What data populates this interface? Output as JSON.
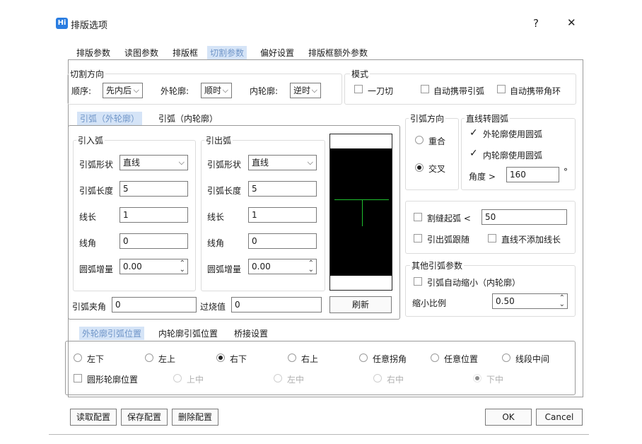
{
  "window": {
    "icon_text": "Hi",
    "title": "排版选项",
    "help": "?",
    "close": "✕"
  },
  "tabs": [
    "排版参数",
    "读图参数",
    "排版框",
    "切割参数",
    "偏好设置",
    "排版框额外参数"
  ],
  "cut_direction": {
    "title": "切割方向",
    "order_label": "顺序:",
    "order_value": "先内后",
    "outer_label": "外轮廓:",
    "outer_value": "顺时",
    "inner_label": "内轮廓:",
    "inner_value": "逆时"
  },
  "mode": {
    "title": "模式",
    "one_cut": "一刀切",
    "auto_arc": "自动携带引弧",
    "auto_ring": "自动携带角环"
  },
  "arc_tabs": [
    "引弧（外轮廓）",
    "引弧（内轮廓）"
  ],
  "lead_in": {
    "title": "引入弧",
    "shape_label": "引弧形状",
    "shape_value": "直线",
    "length_label": "引弧长度",
    "length_value": "5",
    "line_len_label": "线长",
    "line_len_value": "1",
    "line_angle_label": "线角",
    "line_angle_value": "0",
    "arc_inc_label": "圆弧增量",
    "arc_inc_value": "0.00"
  },
  "lead_out": {
    "title": "引出弧",
    "shape_label": "引弧形状",
    "shape_value": "直线",
    "length_label": "引弧长度",
    "length_value": "5",
    "line_len_label": "线长",
    "line_len_value": "1",
    "line_angle_label": "线角",
    "line_angle_value": "0",
    "arc_inc_label": "圆弧增量",
    "arc_inc_value": "0.00"
  },
  "arc_angle": {
    "label": "引弧夹角",
    "value": "0"
  },
  "burn": {
    "label": "过烧值",
    "value": "0"
  },
  "refresh_label": "刷新",
  "arc_direction": {
    "title": "引弧方向",
    "overlap": "重合",
    "cross": "交叉"
  },
  "line_to_arc": {
    "title": "直线转圆弧",
    "outer_use": "外轮廓使用圆弧",
    "inner_use": "内轮廓使用圆弧",
    "angle_label": "角度 >",
    "angle_value": "160",
    "angle_unit": "°"
  },
  "slit": {
    "slit_arc_label": "割缝起弧 <",
    "slit_arc_value": "50",
    "follow_label": "引出弧跟随",
    "no_line_label": "直线不添加线长"
  },
  "other_arc": {
    "title": "其他引弧参数",
    "auto_shrink": "引弧自动缩小（内轮廓）",
    "ratio_label": "缩小比例",
    "ratio_value": "0.50"
  },
  "pos_tabs": [
    "外轮廓引弧位置",
    "内轮廓引弧位置",
    "桥接设置"
  ],
  "positions": [
    "左下",
    "左上",
    "右下",
    "右上",
    "任意拐角",
    "任意位置",
    "线段中间"
  ],
  "round_pos": {
    "label": "圆形轮廓位置",
    "options": [
      "上中",
      "左中",
      "右中",
      "下中"
    ]
  },
  "footer": {
    "read": "读取配置",
    "save": "保存配置",
    "delete": "删除配置",
    "ok": "OK",
    "cancel": "Cancel"
  },
  "colors": {
    "accent": "#2a7de1",
    "tab_active_bg": "#d5e4f7",
    "tab_active_text": "#6f95c8",
    "preview_line": "#1fbf2f"
  }
}
